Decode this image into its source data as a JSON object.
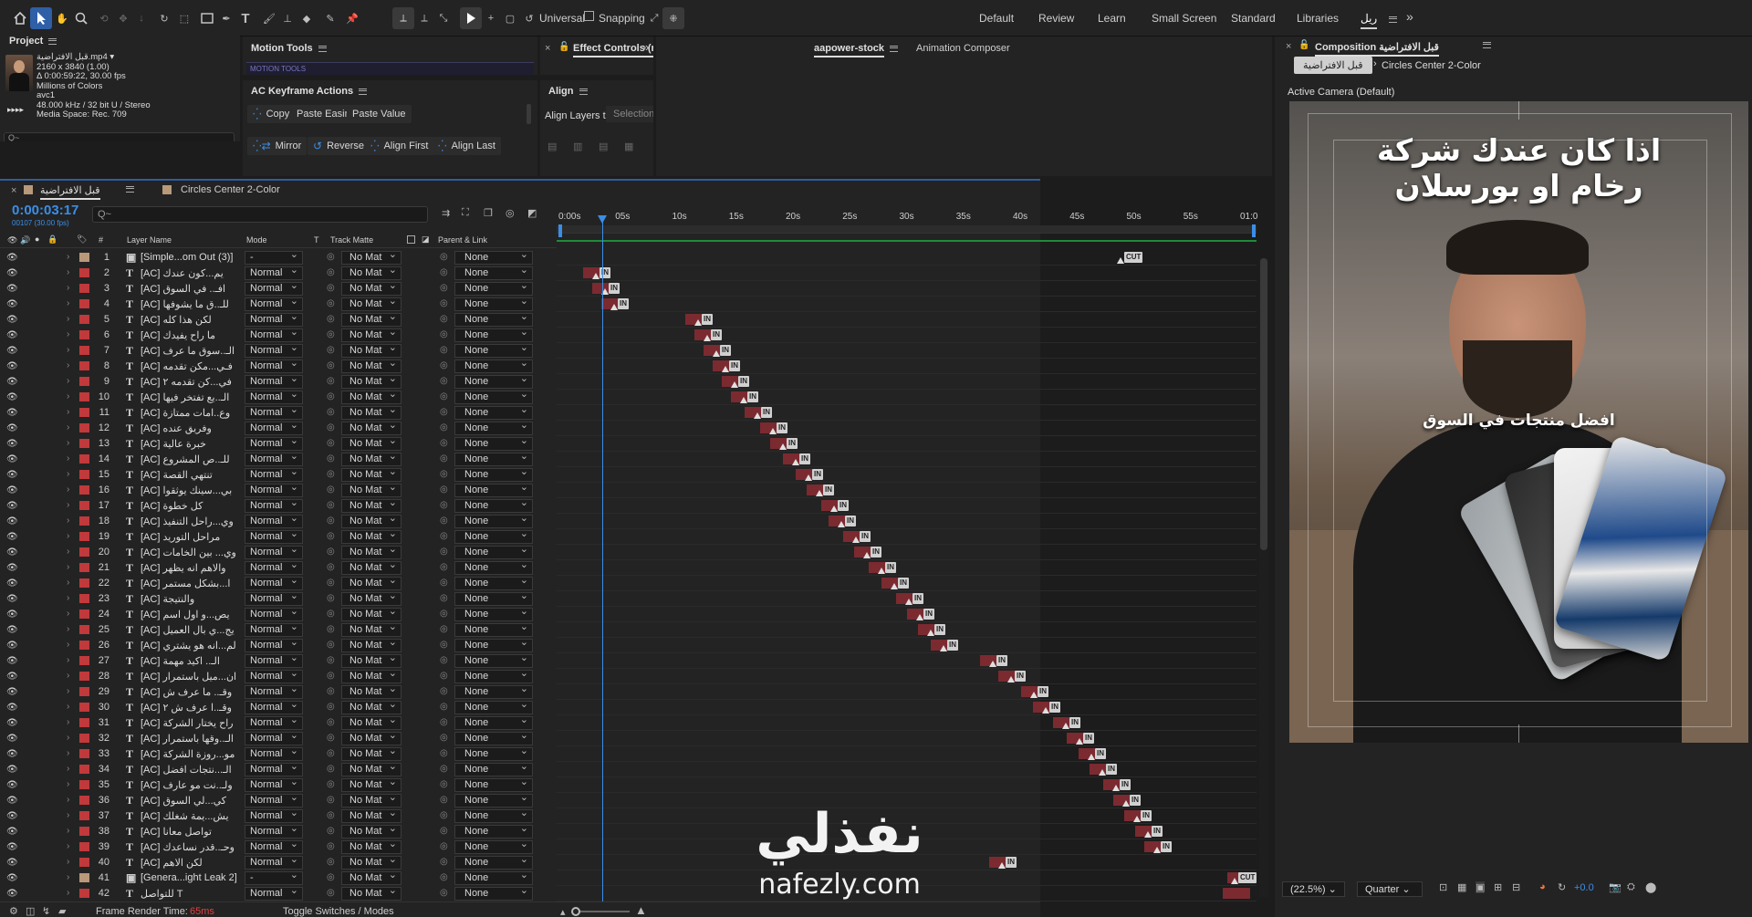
{
  "toolbar": {
    "universal": "Universal",
    "snapping": "Snapping",
    "workspaces": [
      "Default",
      "Review",
      "Learn",
      "Small Screen",
      "Standard",
      "Libraries",
      "ريل"
    ],
    "active_workspace": "ريل"
  },
  "project": {
    "title": "Project",
    "file_name": "قبل الافتراضية.mp4",
    "info": [
      "2160 x 3840 (1.00)",
      "Δ 0:00:59:22, 30.00 fps",
      "Millions of Colors",
      "avc1",
      "48.000 kHz / 32 bit U / Stereo",
      "Media Space: Rec. 709"
    ],
    "search_placeholder": "Q~"
  },
  "motion_tools": {
    "title": "Motion Tools",
    "sub": "MOTION TOOLS"
  },
  "keyframe_actions": {
    "title": "AC Keyframe Actions",
    "row1": [
      "Copy",
      "Paste Easing",
      "Paste Value"
    ],
    "row2": [
      "Mirror",
      "Reverse",
      "Align First",
      "Align Last"
    ]
  },
  "effect_controls": {
    "title": "Effect Controls (n"
  },
  "align": {
    "title": "Align",
    "label": "Align Layers to:",
    "value": "Selection"
  },
  "stock_tabs": {
    "tab1": "aapower-stock",
    "tab2": "Animation Composer"
  },
  "timeline": {
    "tab1": "قبل الافتراضية",
    "tab2": "Circles Center 2-Color",
    "timecode": "0:00:03:17",
    "fps": "00107 (30.00 fps)",
    "search_placeholder": "Q~",
    "headers": {
      "layer_name": "Layer Name",
      "mode": "Mode",
      "t": "T",
      "track_matte": "Track Matte",
      "parent": "Parent & Link",
      "hash": "#"
    },
    "ruler": [
      "0:00s",
      "05s",
      "10s",
      "15s",
      "20s",
      "25s",
      "30s",
      "35s",
      "40s",
      "45s",
      "50s",
      "55s",
      "01:0"
    ],
    "footer": {
      "render_time_label": "Frame Render Time:",
      "render_time": "65ms",
      "toggle": "Toggle Switches / Modes"
    },
    "layers": [
      {
        "n": "1",
        "type": "img",
        "name": "[Simple...om Out (3)]",
        "mode": "-",
        "matte": "No Mat",
        "parent": "None",
        "color": "#b8997a"
      },
      {
        "n": "2",
        "type": "T",
        "name": "[AC] يم...كون عندك",
        "mode": "Normal",
        "matte": "No Mat",
        "parent": "None",
        "color": "#c0393b"
      },
      {
        "n": "3",
        "type": "T",
        "name": "[AC] افـ.. في السوق",
        "mode": "Normal",
        "matte": "No Mat",
        "parent": "None",
        "color": "#c0393b"
      },
      {
        "n": "4",
        "type": "T",
        "name": "[AC] للـ..ق ما يشوفها",
        "mode": "Normal",
        "matte": "No Mat",
        "parent": "None",
        "color": "#c0393b"
      },
      {
        "n": "5",
        "type": "T",
        "name": "[AC] لكن هذا كله",
        "mode": "Normal",
        "matte": "No Mat",
        "parent": "None",
        "color": "#c0393b"
      },
      {
        "n": "6",
        "type": "T",
        "name": "[AC] ما راح يفيدك",
        "mode": "Normal",
        "matte": "No Mat",
        "parent": "None",
        "color": "#c0393b"
      },
      {
        "n": "7",
        "type": "T",
        "name": "[AC] الـ..سوق ما عرف",
        "mode": "Normal",
        "matte": "No Mat",
        "parent": "None",
        "color": "#c0393b"
      },
      {
        "n": "8",
        "type": "T",
        "name": "[AC] فـي...مكن تقدمه",
        "mode": "Normal",
        "matte": "No Mat",
        "parent": "None",
        "color": "#c0393b"
      },
      {
        "n": "9",
        "type": "T",
        "name": "[AC] في...كن تقدمه ٢",
        "mode": "Normal",
        "matte": "No Mat",
        "parent": "None",
        "color": "#c0393b"
      },
      {
        "n": "10",
        "type": "T",
        "name": "[AC] الـ..يع تفتخر فيها",
        "mode": "Normal",
        "matte": "No Mat",
        "parent": "None",
        "color": "#c0393b"
      },
      {
        "n": "11",
        "type": "T",
        "name": "[AC] وع..امات ممتازة",
        "mode": "Normal",
        "matte": "No Mat",
        "parent": "None",
        "color": "#c0393b"
      },
      {
        "n": "12",
        "type": "T",
        "name": "[AC] وفريق عنده",
        "mode": "Normal",
        "matte": "No Mat",
        "parent": "None",
        "color": "#c0393b"
      },
      {
        "n": "13",
        "type": "T",
        "name": "[AC] خبرة عالية",
        "mode": "Normal",
        "matte": "No Mat",
        "parent": "None",
        "color": "#c0393b"
      },
      {
        "n": "14",
        "type": "T",
        "name": "[AC] للـ..ص المشروع",
        "mode": "Normal",
        "matte": "No Mat",
        "parent": "None",
        "color": "#c0393b"
      },
      {
        "n": "15",
        "type": "T",
        "name": "[AC] تنتهي القصة",
        "mode": "Normal",
        "matte": "No Mat",
        "parent": "None",
        "color": "#c0393b"
      },
      {
        "n": "16",
        "type": "T",
        "name": "[AC] بي...سينك يوثقوا",
        "mode": "Normal",
        "matte": "No Mat",
        "parent": "None",
        "color": "#c0393b"
      },
      {
        "n": "17",
        "type": "T",
        "name": "[AC] كل خطوة",
        "mode": "Normal",
        "matte": "No Mat",
        "parent": "None",
        "color": "#c0393b"
      },
      {
        "n": "18",
        "type": "T",
        "name": "[AC] وي...راحل التنفيذ",
        "mode": "Normal",
        "matte": "No Mat",
        "parent": "None",
        "color": "#c0393b"
      },
      {
        "n": "19",
        "type": "T",
        "name": "[AC] مراحل التوريد",
        "mode": "Normal",
        "matte": "No Mat",
        "parent": "None",
        "color": "#c0393b"
      },
      {
        "n": "20",
        "type": "T",
        "name": "[AC] وي... بين الخامات",
        "mode": "Normal",
        "matte": "No Mat",
        "parent": "None",
        "color": "#c0393b"
      },
      {
        "n": "21",
        "type": "T",
        "name": "[AC] والاهم انه يظهر",
        "mode": "Normal",
        "matte": "No Mat",
        "parent": "None",
        "color": "#c0393b"
      },
      {
        "n": "22",
        "type": "T",
        "name": "[AC] ا...بشكل مستمر",
        "mode": "Normal",
        "matte": "No Mat",
        "parent": "None",
        "color": "#c0393b"
      },
      {
        "n": "23",
        "type": "T",
        "name": "[AC] والنتيجة",
        "mode": "Normal",
        "matte": "No Mat",
        "parent": "None",
        "color": "#c0393b"
      },
      {
        "n": "24",
        "type": "T",
        "name": "[AC] يص...و اول اسم",
        "mode": "Normal",
        "matte": "No Mat",
        "parent": "None",
        "color": "#c0393b"
      },
      {
        "n": "25",
        "type": "T",
        "name": "[AC] يج...ي بال العميل",
        "mode": "Normal",
        "matte": "No Mat",
        "parent": "None",
        "color": "#c0393b"
      },
      {
        "n": "26",
        "type": "T",
        "name": "[AC] لم...انه هو يشتري",
        "mode": "Normal",
        "matte": "No Mat",
        "parent": "None",
        "color": "#c0393b"
      },
      {
        "n": "27",
        "type": "T",
        "name": "[AC] الـ.. اكيد مهمة",
        "mode": "Normal",
        "matte": "No Mat",
        "parent": "None",
        "color": "#c0393b"
      },
      {
        "n": "28",
        "type": "T",
        "name": "[AC] ان...ميل باستمرار",
        "mode": "Normal",
        "matte": "No Mat",
        "parent": "None",
        "color": "#c0393b"
      },
      {
        "n": "29",
        "type": "T",
        "name": "[AC] وقـ.. ما عرف ش",
        "mode": "Normal",
        "matte": "No Mat",
        "parent": "None",
        "color": "#c0393b"
      },
      {
        "n": "30",
        "type": "T",
        "name": "[AC] وقـ..ا عرف ش ٢",
        "mode": "Normal",
        "matte": "No Mat",
        "parent": "None",
        "color": "#c0393b"
      },
      {
        "n": "31",
        "type": "T",
        "name": "[AC] راح يختار الشركة",
        "mode": "Normal",
        "matte": "No Mat",
        "parent": "None",
        "color": "#c0393b"
      },
      {
        "n": "32",
        "type": "T",
        "name": "[AC] الـ..وقها باستمرار",
        "mode": "Normal",
        "matte": "No Mat",
        "parent": "None",
        "color": "#c0393b"
      },
      {
        "n": "33",
        "type": "T",
        "name": "[AC] مو...روزة الشركة",
        "mode": "Normal",
        "matte": "No Mat",
        "parent": "None",
        "color": "#c0393b"
      },
      {
        "n": "34",
        "type": "T",
        "name": "[AC] الـ...نتجات افضل",
        "mode": "Normal",
        "matte": "No Mat",
        "parent": "None",
        "color": "#c0393b"
      },
      {
        "n": "35",
        "type": "T",
        "name": "[AC] ولـ..نت مو عارف",
        "mode": "Normal",
        "matte": "No Mat",
        "parent": "None",
        "color": "#c0393b"
      },
      {
        "n": "36",
        "type": "T",
        "name": "[AC] كي...لي السوق",
        "mode": "Normal",
        "matte": "No Mat",
        "parent": "None",
        "color": "#c0393b"
      },
      {
        "n": "37",
        "type": "T",
        "name": "[AC] يش...يمة شغلك",
        "mode": "Normal",
        "matte": "No Mat",
        "parent": "None",
        "color": "#c0393b"
      },
      {
        "n": "38",
        "type": "T",
        "name": "[AC] تواصل معانا",
        "mode": "Normal",
        "matte": "No Mat",
        "parent": "None",
        "color": "#c0393b"
      },
      {
        "n": "39",
        "type": "T",
        "name": "[AC] وحـ..قدر نساعدك",
        "mode": "Normal",
        "matte": "No Mat",
        "parent": "None",
        "color": "#c0393b"
      },
      {
        "n": "40",
        "type": "T",
        "name": "[AC] لكن الاهم",
        "mode": "Normal",
        "matte": "No Mat",
        "parent": "None",
        "color": "#c0393b"
      },
      {
        "n": "41",
        "type": "img",
        "name": "[Genera...ight Leak 2]",
        "mode": "-",
        "matte": "No Mat",
        "parent": "None",
        "color": "#b8997a"
      },
      {
        "n": "42",
        "type": "T",
        "name": "للتواصل T",
        "mode": "Normal",
        "matte": "No Mat",
        "parent": "None",
        "color": "#c0393b"
      }
    ],
    "clips": [
      {
        "layer": 1,
        "tag": "CUT",
        "tri": false
      },
      {
        "layer": 2,
        "tag": "IN"
      },
      {
        "layer": 3,
        "tag": "IN"
      },
      {
        "layer": 4,
        "tag": "IN"
      },
      {
        "layer": 5,
        "tag": "IN"
      },
      {
        "layer": 6,
        "tag": "IN"
      },
      {
        "layer": 7,
        "tag": "IN"
      },
      {
        "layer": 8,
        "tag": "IN"
      },
      {
        "layer": 9,
        "tag": "IN"
      },
      {
        "layer": 10,
        "tag": "IN"
      },
      {
        "layer": 11,
        "tag": "IN"
      },
      {
        "layer": 12,
        "tag": "IN"
      },
      {
        "layer": 13,
        "tag": "IN"
      },
      {
        "layer": 14,
        "tag": "IN"
      },
      {
        "layer": 15,
        "tag": "IN"
      },
      {
        "layer": 16,
        "tag": "IN"
      },
      {
        "layer": 17,
        "tag": "IN"
      },
      {
        "layer": 18,
        "tag": "IN"
      },
      {
        "layer": 19,
        "tag": "IN"
      },
      {
        "layer": 20,
        "tag": "IN"
      },
      {
        "layer": 21,
        "tag": "IN"
      },
      {
        "layer": 22,
        "tag": "IN"
      },
      {
        "layer": 23,
        "tag": "IN"
      },
      {
        "layer": 24,
        "tag": "IN"
      },
      {
        "layer": 25,
        "tag": "IN"
      },
      {
        "layer": 26,
        "tag": "IN"
      },
      {
        "layer": 27,
        "tag": "IN"
      },
      {
        "layer": 28,
        "tag": "IN"
      },
      {
        "layer": 29,
        "tag": "IN"
      },
      {
        "layer": 30,
        "tag": "IN"
      },
      {
        "layer": 31,
        "tag": "IN"
      },
      {
        "layer": 32,
        "tag": "IN"
      },
      {
        "layer": 33,
        "tag": "IN"
      },
      {
        "layer": 34,
        "tag": "IN"
      },
      {
        "layer": 35,
        "tag": "IN"
      },
      {
        "layer": 36,
        "tag": "IN"
      },
      {
        "layer": 37,
        "tag": "IN"
      },
      {
        "layer": 38,
        "tag": "IN"
      },
      {
        "layer": 39,
        "tag": "IN"
      },
      {
        "layer": 40,
        "tag": "IN"
      },
      {
        "layer": 41,
        "tag": "CUT"
      },
      {
        "layer": 42,
        "tag": ""
      }
    ]
  },
  "composition": {
    "title": "Composition قبل الافتراضية",
    "breadcrumb1": "قبل الافتراضية",
    "breadcrumb2": "Circles Center 2-Color",
    "camera": "Active Camera (Default)",
    "headline1": "اذا كان عندك شركة",
    "headline2": "رخام او بورسلان",
    "caption": "افضل منتجات في السوق",
    "zoom": "(22.5%)",
    "quality": "Quarter",
    "exposure": "+0.0"
  },
  "watermark": {
    "arabic": "نفذلي",
    "url": "nafezly.com"
  },
  "colors": {
    "accent": "#2f5fa6",
    "clip_bar": "#7b2a30",
    "label_red": "#c0393b",
    "playhead": "#3b8ee6"
  }
}
